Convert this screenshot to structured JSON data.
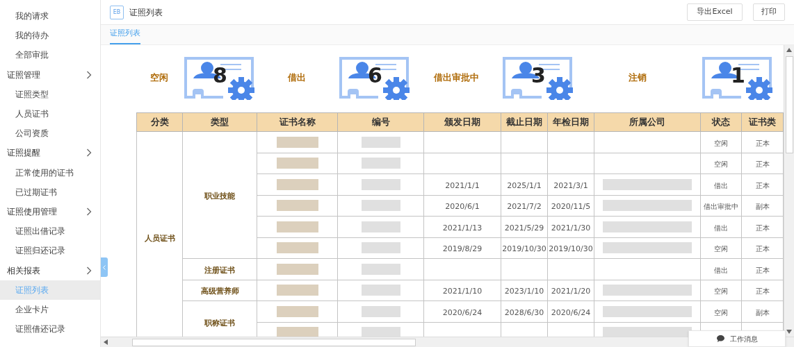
{
  "sidebar": {
    "items": [
      {
        "label": "我的请求",
        "kind": "link",
        "selected": false
      },
      {
        "label": "我的待办",
        "kind": "link",
        "selected": false
      },
      {
        "label": "全部审批",
        "kind": "link",
        "selected": false
      },
      {
        "label": "证照管理",
        "kind": "group",
        "selected": false
      },
      {
        "label": "证照类型",
        "kind": "link",
        "selected": false
      },
      {
        "label": "人员证书",
        "kind": "link",
        "selected": false
      },
      {
        "label": "公司资质",
        "kind": "link",
        "selected": false
      },
      {
        "label": "证照提醒",
        "kind": "group",
        "selected": false
      },
      {
        "label": "正常使用的证书",
        "kind": "link",
        "selected": false
      },
      {
        "label": "已过期证书",
        "kind": "link",
        "selected": false
      },
      {
        "label": "证照使用管理",
        "kind": "group",
        "selected": false
      },
      {
        "label": "证照出借记录",
        "kind": "link",
        "selected": false
      },
      {
        "label": "证照归还记录",
        "kind": "link",
        "selected": false
      },
      {
        "label": "相关报表",
        "kind": "group",
        "selected": false
      },
      {
        "label": "证照列表",
        "kind": "link",
        "selected": true
      },
      {
        "label": "企业卡片",
        "kind": "link",
        "selected": false
      },
      {
        "label": "证照借还记录",
        "kind": "link",
        "selected": false
      }
    ]
  },
  "header": {
    "badge": "EB",
    "title": "证照列表",
    "buttons": [
      "导出Excel",
      "打印"
    ]
  },
  "tabs": [
    {
      "label": "证照列表",
      "selected": true
    }
  ],
  "stats": [
    {
      "label": "空闲",
      "count": "8"
    },
    {
      "label": "借出",
      "count": "6"
    },
    {
      "label": "借出审批中",
      "count": "3"
    },
    {
      "label": "注销",
      "count": "1"
    }
  ],
  "table": {
    "columns": [
      {
        "label": "分类"
      },
      {
        "label": "类型"
      },
      {
        "label": "证书名称"
      },
      {
        "label": "编号"
      },
      {
        "label": "颁发日期"
      },
      {
        "label": "截止日期"
      },
      {
        "label": "年检日期"
      },
      {
        "label": "所属公司"
      },
      {
        "label": "状态"
      },
      {
        "label": "证书类"
      }
    ],
    "groups": [
      {
        "category": "人员证书",
        "types": [
          {
            "type": "职业技能",
            "rows": [
              {
                "company_redacted": false,
                "status": "空闲",
                "cert_kind": "正本"
              },
              {
                "company_redacted": false,
                "status": "空闲",
                "cert_kind": "正本"
              },
              {
                "issue_date": "2021/1/1",
                "expiry_date": "2025/1/1",
                "inspection_date": "2021/3/1",
                "company_redacted": true,
                "status": "借出",
                "cert_kind": "正本"
              },
              {
                "issue_date": "2020/6/1",
                "expiry_date": "2021/7/2",
                "inspection_date": "2020/11/5",
                "company_redacted": true,
                "status": "借出审批中",
                "cert_kind": "副本"
              },
              {
                "issue_date": "2021/1/13",
                "expiry_date": "2021/5/29",
                "inspection_date": "2021/1/30",
                "company_redacted": true,
                "status": "借出",
                "cert_kind": "正本"
              },
              {
                "issue_date": "2019/8/29",
                "expiry_date": "2019/10/30",
                "inspection_date": "2019/10/30",
                "company_redacted": true,
                "status": "空闲",
                "cert_kind": "正本"
              }
            ]
          },
          {
            "type": "注册证书",
            "rows": [
              {
                "company_redacted": false,
                "status": "借出",
                "cert_kind": "正本"
              }
            ]
          },
          {
            "type": "高级营养师",
            "rows": [
              {
                "issue_date": "2021/1/10",
                "expiry_date": "2023/1/10",
                "inspection_date": "2021/1/20",
                "company_redacted": true,
                "status": "空闲",
                "cert_kind": "正本"
              }
            ]
          },
          {
            "type": "职称证书",
            "rows": [
              {
                "issue_date": "2020/6/24",
                "expiry_date": "2028/6/30",
                "inspection_date": "2020/6/24",
                "company_redacted": true,
                "status": "空闲",
                "cert_kind": "副本"
              },
              {
                "company_redacted": true
              }
            ]
          }
        ]
      }
    ]
  },
  "widget": {
    "label": "工作消息"
  }
}
